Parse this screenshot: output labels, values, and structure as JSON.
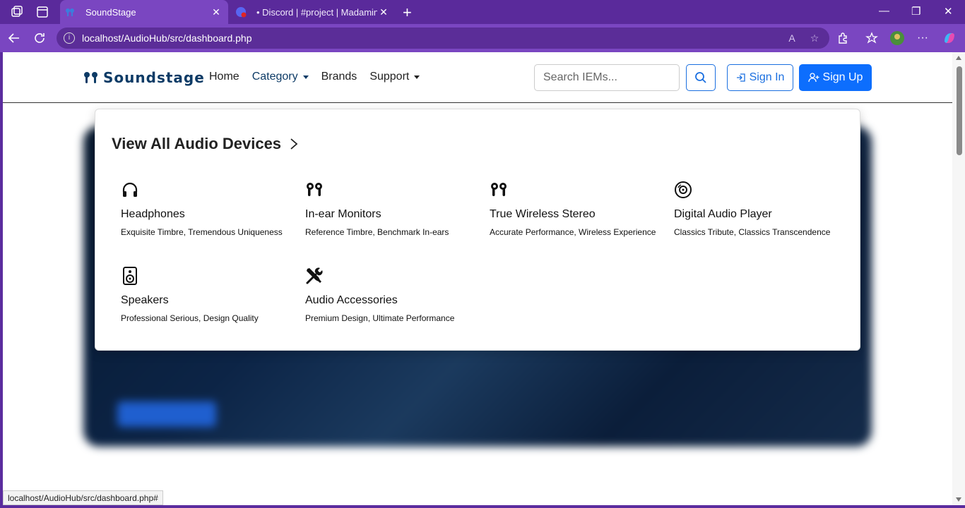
{
  "browser": {
    "tabs": [
      {
        "title": "SoundStage",
        "active": true
      },
      {
        "title": "• Discord | #project | Madaming T",
        "active": false
      }
    ],
    "address": "localhost/AudioHub/src/dashboard.php",
    "status_url": "localhost/AudioHub/src/dashboard.php#"
  },
  "header": {
    "logo": "Soundstage",
    "menu": {
      "home": "Home",
      "category": "Category",
      "brands": "Brands",
      "support": "Support"
    },
    "search_placeholder": "Search IEMs...",
    "sign_in": "Sign In",
    "sign_up": "Sign Up"
  },
  "dropdown": {
    "heading": "View All Audio Devices",
    "items": [
      {
        "name": "Headphones",
        "desc": "Exquisite Timbre, Tremendous Uniqueness",
        "icon": "headphones-icon"
      },
      {
        "name": "In-ear Monitors",
        "desc": "Reference Timbre, Benchmark In-ears",
        "icon": "earbuds-icon"
      },
      {
        "name": "True Wireless Stereo",
        "desc": "Accurate Performance, Wireless Experience",
        "icon": "earbuds-icon"
      },
      {
        "name": "Digital Audio Player",
        "desc": "Classics Tribute, Classics Transcendence",
        "icon": "disc-icon"
      },
      {
        "name": "Speakers",
        "desc": "Professional Serious, Design Quality",
        "icon": "speaker-icon"
      },
      {
        "name": "Audio Accessories",
        "desc": "Premium Design, Ultimate Performance",
        "icon": "tools-icon"
      }
    ]
  },
  "colors": {
    "brand": "#0d3b66",
    "primary": "#0d6efd",
    "chrome": "#7a46c1"
  }
}
